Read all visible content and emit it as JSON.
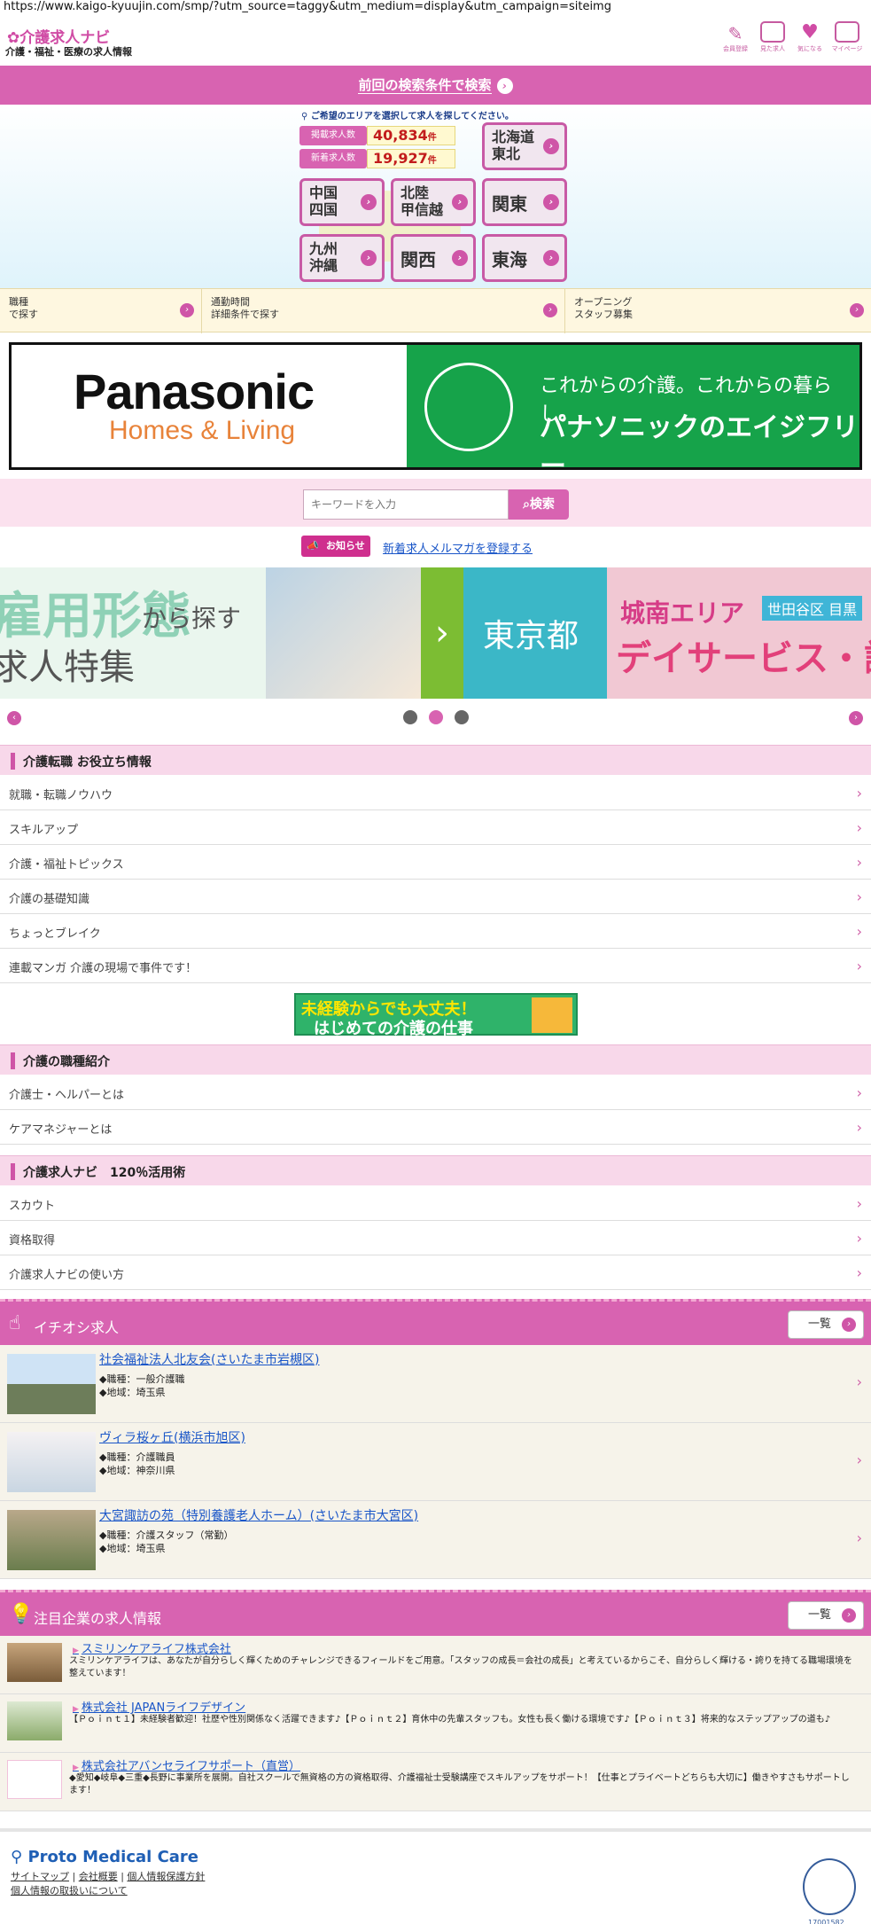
{
  "url": "https://www.kaigo-kyuujin.com/smp/?utm_source=taggy&utm_medium=display&utm_campaign=siteimg",
  "header": {
    "logo": "介護求人ナビ",
    "tagline": "介護・福祉・医療の求人情報",
    "icons": [
      {
        "label": "会員登録",
        "icon": "pen-icon"
      },
      {
        "label": "見た求人",
        "icon": "calendar-icon"
      },
      {
        "label": "気になる",
        "icon": "heart-icon"
      },
      {
        "label": "マイページ",
        "icon": "card-icon"
      }
    ]
  },
  "prev_search": "前回の検索条件で検索",
  "map": {
    "note": "ご希望のエリアを選択して求人を探してください。",
    "stats": [
      {
        "label": "掲載求人数",
        "value": "40,834",
        "unit": "件"
      },
      {
        "label": "新着求人数",
        "value": "19,927",
        "unit": "件"
      }
    ],
    "regions": [
      [
        "北海道",
        "東北"
      ],
      [
        "中国",
        "四国"
      ],
      [
        "北陸",
        "甲信越"
      ],
      [
        "関東"
      ],
      [
        "九州",
        "沖縄"
      ],
      [
        "関西"
      ],
      [
        "東海"
      ]
    ]
  },
  "search3": [
    {
      "l1": "職種",
      "l2": "で探す"
    },
    {
      "l1": "通勤時間",
      "l2": "詳細条件で探す"
    },
    {
      "l1": "オープニング",
      "l2": "スタッフ募集"
    }
  ],
  "ad": {
    "brand": "Panasonic",
    "sub": "Homes & Living",
    "copy1": "これからの介護。これからの暮らし。",
    "copy2": "パナソニックのエイジフリー"
  },
  "keyword": {
    "placeholder": "キーワードを入力",
    "button": "検索"
  },
  "news": {
    "badge": "お知らせ",
    "link": "新着求人メルマガを登録する"
  },
  "carousel": {
    "s1a": "雇用形態",
    "s1b": "から探す",
    "s1c": "求人特集",
    "s2": "東京都",
    "s3a": "城南エリア",
    "s3b": "デイサービス・訪",
    "s3c": "世田谷区 目黒"
  },
  "sections": [
    {
      "title": "介護転職 お役立ち情報",
      "items": [
        "就職・転職ノウハウ",
        "スキルアップ",
        "介護・福祉トピックス",
        "介護の基礎知識",
        "ちょっとブレイク",
        "連載マンガ 介護の現場で事件です！"
      ]
    },
    {
      "title": "介護の職種紹介",
      "items": [
        "介護士・ヘルパーとは",
        "ケアマネジャーとは"
      ]
    },
    {
      "title": "介護求人ナビ　120％活用術",
      "items": [
        "スカウト",
        "資格取得",
        "介護求人ナビの使い方"
      ]
    }
  ],
  "mid_banner": {
    "a": "未経験からでも大丈夫！",
    "b": "はじめての介護の仕事"
  },
  "pickup": {
    "title": "イチオシ求人",
    "list_btn": "一覧",
    "jobs": [
      {
        "name": "社会福祉法人北友会(さいたま市岩槻区)",
        "job": "◆職種：一般介護職",
        "area": "◆地域：埼玉県"
      },
      {
        "name": "ヴィラ桜ヶ丘(横浜市旭区)",
        "job": "◆職種：介護職員",
        "area": "◆地域：神奈川県"
      },
      {
        "name": "大宮諏訪の苑（特別養護老人ホーム）(さいたま市大宮区)",
        "job": "◆職種：介護スタッフ（常勤）",
        "area": "◆地域：埼玉県"
      }
    ]
  },
  "companies": {
    "title": "注目企業の求人情報",
    "list_btn": "一覧",
    "items": [
      {
        "name": "スミリンケアライフ株式会社",
        "desc": "スミリンケアライフは、あなたが自分らしく輝くためのチャレンジできるフィールドをご用意。「スタッフの成長＝会社の成長」と考えているからこそ、自分らしく輝ける・誇りを持てる職場環境を整えています！"
      },
      {
        "name": "株式会社 JAPANライフデザイン",
        "desc": "【Ｐｏｉｎｔ１】未経験者歓迎！社歴や性別関係なく活躍できます♪【Ｐｏｉｎｔ２】育休中の先輩スタッフも。女性も長く働ける環境です♪【Ｐｏｉｎｔ３】将来的なステップアップの道も♪"
      },
      {
        "name": "株式会社アバンセライフサポート（直営）",
        "desc": "◆愛知◆岐阜◆三重◆長野に事業所を展開。自社スクールで無資格の方の資格取得、介護福祉士受験講座でスキルアップをサポート！【仕事とプライベートどちらも大切に】働きやすさもサポートします！"
      }
    ]
  },
  "footer": {
    "brand": "Proto Medical Care",
    "links": [
      "サイトマップ",
      "会社概要",
      "個人情報保護方針"
    ],
    "link2": "個人情報の取扱いについて",
    "pmark": "17001582"
  }
}
